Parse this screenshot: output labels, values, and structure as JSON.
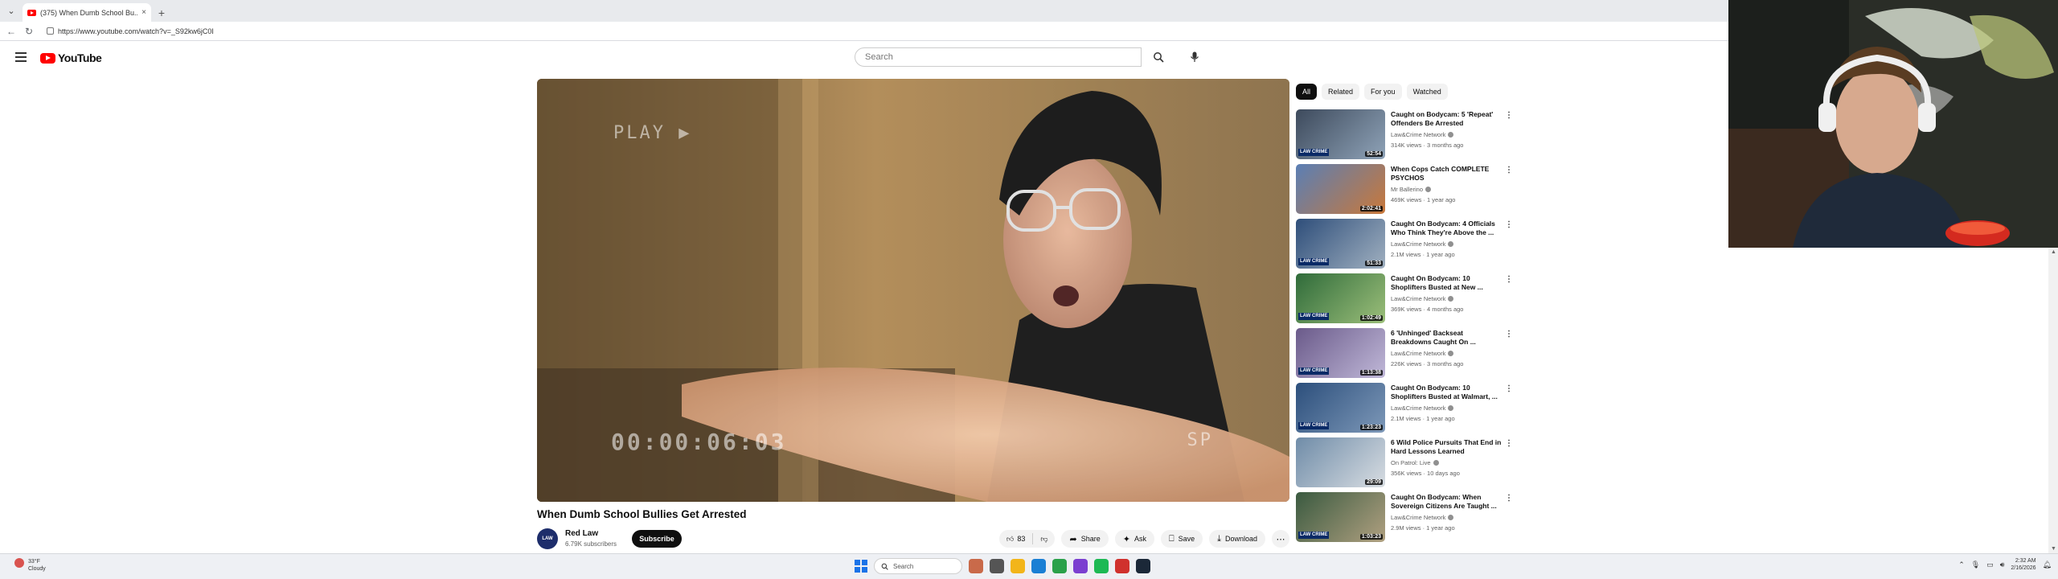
{
  "browser": {
    "tab_title": "(375) When Dumb School Bu...",
    "tab_close": "×",
    "new_tab": "+",
    "url": "https://www.youtube.com/watch?v=_S92kw6jC0I"
  },
  "masthead": {
    "logo_text": "YouTube",
    "search_placeholder": "Search"
  },
  "player": {
    "osd_play": "PLAY ▶",
    "osd_timecode": "00:00:06:03",
    "osd_mode": "SP"
  },
  "video": {
    "title": "When Dumb School Bullies Get Arrested",
    "channel_name": "Red Law",
    "channel_avatar": "LAW",
    "subscribers": "6.79K subscribers",
    "subscribe_label": "Subscribe",
    "likes": "83",
    "share_label": "Share",
    "ask_label": "Ask",
    "save_label": "Save",
    "download_label": "Download"
  },
  "sidebar": {
    "chips": [
      "All",
      "Related",
      "For you",
      "Watched"
    ],
    "items": [
      {
        "title": "Caught on Bodycam: 5 'Repeat' Offenders Be Arrested",
        "channel": "Law&Crime Network",
        "meta": "314K views · 3 months ago",
        "duration": "52:54",
        "brand": "LAW CRIME",
        "c1": "#3d4a5c",
        "c2": "#8fa3b8"
      },
      {
        "title": "When Cops Catch COMPLETE PSYCHOS",
        "channel": "Mr Ballerino",
        "meta": "469K views · 1 year ago",
        "duration": "2:02:41",
        "brand": "",
        "c1": "#5a7fb5",
        "c2": "#c9783a"
      },
      {
        "title": "Caught On Bodycam: 4 Officials Who Think They're Above the ...",
        "channel": "Law&Crime Network",
        "meta": "2.1M views · 1 year ago",
        "duration": "51:33",
        "brand": "LAW CRIME",
        "c1": "#2e4e7a",
        "c2": "#a0b0c0"
      },
      {
        "title": "Caught On Bodycam: 10 Shoplifters Busted at New ...",
        "channel": "Law&Crime Network",
        "meta": "369K views · 4 months ago",
        "duration": "1:02:49",
        "brand": "LAW CRIME",
        "c1": "#2f6b3a",
        "c2": "#9cbf7a"
      },
      {
        "title": "6 'Unhinged' Backseat Breakdowns Caught On ...",
        "channel": "Law&Crime Network",
        "meta": "226K views · 3 months ago",
        "duration": "1:13:38",
        "brand": "LAW CRIME",
        "c1": "#6a5a8a",
        "c2": "#c0b8d8"
      },
      {
        "title": "Caught On Bodycam: 10 Shoplifters Busted at Walmart, ...",
        "channel": "Law&Crime Network",
        "meta": "2.1M views · 1 year ago",
        "duration": "1:23:23",
        "brand": "LAW CRIME",
        "c1": "#2c4f7c",
        "c2": "#7d98b8"
      },
      {
        "title": "6 Wild Police Pursuits That End in Hard Lessons Learned",
        "channel": "On Patrol: Live",
        "meta": "356K views · 10 days ago",
        "duration": "29:09",
        "brand": "",
        "c1": "#6f8ca8",
        "c2": "#d8dde2"
      },
      {
        "title": "Caught On Bodycam: When Sovereign Citizens Are Taught ...",
        "channel": "Law&Crime Network",
        "meta": "2.9M views · 1 year ago",
        "duration": "1:03:23",
        "brand": "LAW CRIME",
        "c1": "#3a5a40",
        "c2": "#b0a080"
      }
    ]
  },
  "taskbar": {
    "weather_temp": "33°F",
    "weather_desc": "Cloudy",
    "search_label": "Search",
    "time": "2:32 AM",
    "date": "2/16/2026"
  },
  "colors": {
    "youtube_red": "#ff0000",
    "subscribe_bg": "#0f0f0f",
    "chip_active": "#0f0f0f"
  }
}
